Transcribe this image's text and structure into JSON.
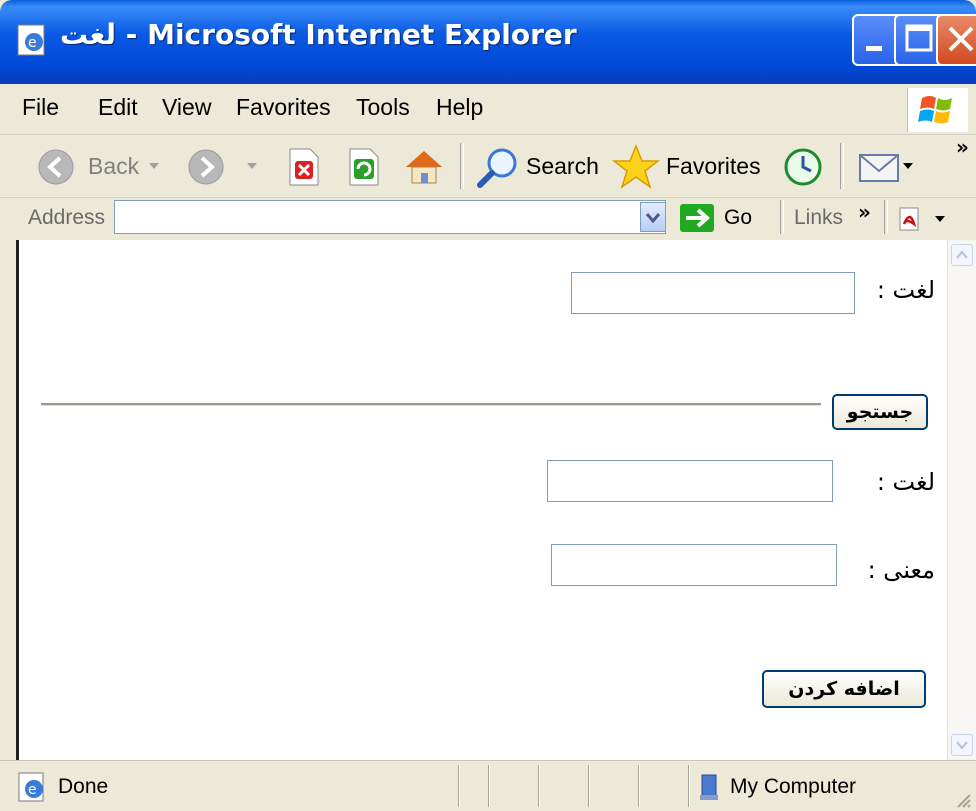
{
  "window": {
    "title": "لغت - Microsoft Internet Explorer"
  },
  "menu": {
    "items": [
      "File",
      "Edit",
      "View",
      "Favorites",
      "Tools",
      "Help"
    ]
  },
  "toolbar": {
    "back_label": "Back",
    "search_label": "Search",
    "favorites_label": "Favorites",
    "overflow": "»"
  },
  "address_bar": {
    "label": "Address",
    "value": "",
    "go_label": "Go",
    "links_label": "Links",
    "links_overflow": "»"
  },
  "form": {
    "search_word_label": "لغت :",
    "search_word_value": "",
    "search_button": "جستجو",
    "add_word_label": "لغت :",
    "add_word_value": "",
    "meaning_label": "معنی :",
    "meaning_value": "",
    "add_button": "اضافه کردن"
  },
  "status_bar": {
    "status": "Done",
    "zone": "My Computer"
  },
  "colors": {
    "titlebar": "#0a5ae4",
    "chrome": "#ece9d8",
    "input_border": "#7f9db9",
    "button_border": "#003c74"
  }
}
